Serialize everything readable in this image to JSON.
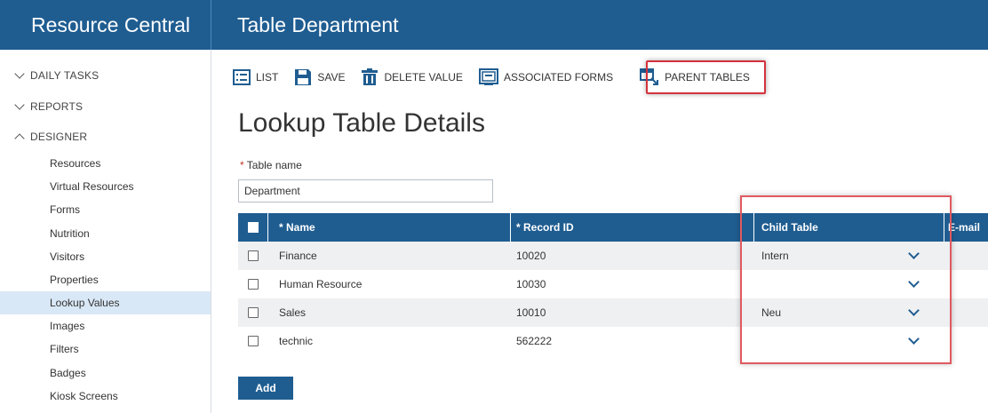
{
  "header": {
    "brand": "Resource Central",
    "page_title": "Table Department"
  },
  "sidebar": {
    "groups": [
      {
        "label": "DAILY TASKS",
        "state": "collapsed"
      },
      {
        "label": "REPORTS",
        "state": "collapsed"
      },
      {
        "label": "DESIGNER",
        "state": "expanded"
      }
    ],
    "items": [
      {
        "label": "Resources"
      },
      {
        "label": "Virtual Resources"
      },
      {
        "label": "Forms"
      },
      {
        "label": "Nutrition"
      },
      {
        "label": "Visitors"
      },
      {
        "label": "Properties"
      },
      {
        "label": "Lookup Values",
        "active": true
      },
      {
        "label": "Images"
      },
      {
        "label": "Filters"
      },
      {
        "label": "Badges"
      },
      {
        "label": "Kiosk Screens"
      }
    ]
  },
  "toolbar": {
    "list": "LIST",
    "save": "SAVE",
    "delete": "DELETE VALUE",
    "associated": "ASSOCIATED FORMS",
    "parent": "PARENT TABLES"
  },
  "main": {
    "title": "Lookup Table Details",
    "table_name_label": "Table name",
    "required_mark": "*",
    "table_name_value": "Department"
  },
  "table": {
    "columns": {
      "name": "* Name",
      "record_id": "* Record ID",
      "child_table": "Child Table",
      "email": "E-mail"
    },
    "rows": [
      {
        "name": "Finance",
        "record_id": "10020",
        "child_table": "Intern"
      },
      {
        "name": "Human Resource",
        "record_id": "10030",
        "child_table": ""
      },
      {
        "name": "Sales",
        "record_id": "10010",
        "child_table": "Neu"
      },
      {
        "name": "technic",
        "record_id": "562222",
        "child_table": ""
      }
    ]
  },
  "actions": {
    "add": "Add"
  },
  "colors": {
    "primary": "#1f5d91",
    "highlight": "#d3323c",
    "active_nav": "#d9e8f6"
  }
}
